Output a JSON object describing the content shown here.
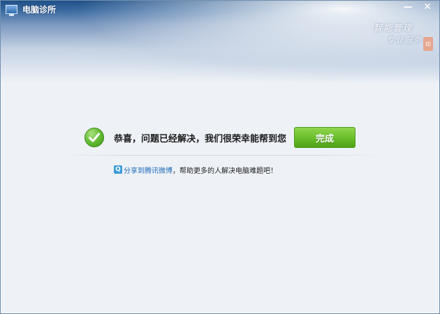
{
  "window": {
    "title": "电脑诊所",
    "minimize_symbol": "—",
    "close_symbol": "✕",
    "app_icon": "monitor-icon"
  },
  "banner": {
    "slogan_line1": "智能管理",
    "slogan_line2": "专业服务"
  },
  "result": {
    "icon": "check-circle-icon",
    "message": "恭喜，问题已经解决，我们很荣幸能帮到您",
    "done_label": "完成"
  },
  "share": {
    "icon": "tencent-weibo-icon",
    "link_text": "分享到腾讯微博",
    "suffix_text": "，帮助更多的人解决电脑难题吧！"
  },
  "colors": {
    "accent_green": "#6cc02c",
    "link_blue": "#1f6bb8",
    "titlebar_blue": "#1f4f86"
  }
}
